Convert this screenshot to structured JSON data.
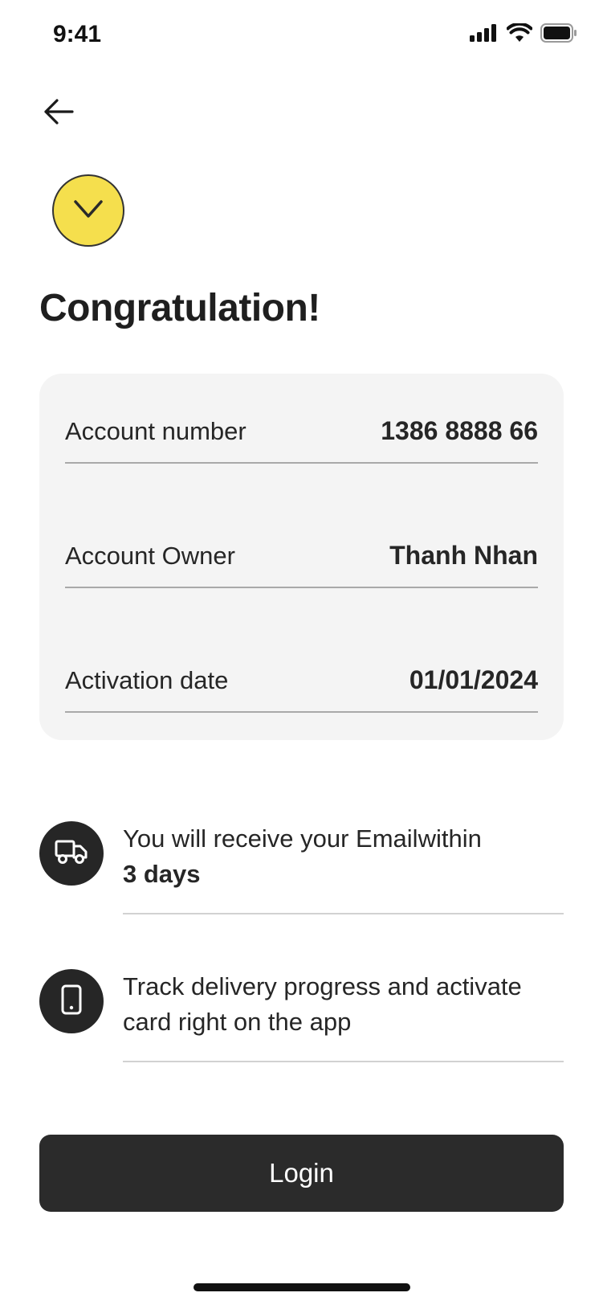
{
  "status_bar": {
    "time": "9:41",
    "icons": [
      "cellular-signal-icon",
      "wifi-icon",
      "battery-icon"
    ]
  },
  "header": {
    "back_icon": "arrow-left-icon"
  },
  "success_icon": "check-icon",
  "title": "Congratulation!",
  "details": [
    {
      "label": "Account number",
      "value": "1386 8888 66"
    },
    {
      "label": "Account Owner",
      "value": "Thanh Nhan"
    },
    {
      "label": "Activation date",
      "value": "01/01/2024"
    }
  ],
  "features": [
    {
      "icon": "truck-icon",
      "text": "You will receive your Emailwithin",
      "bold": "3 days"
    },
    {
      "icon": "smartphone-icon",
      "text": "Track delivery progress and activate card right on the app"
    }
  ],
  "login_button": {
    "label": "Login"
  },
  "colors": {
    "accent_yellow": "#F5DF4D",
    "dark": "#2B2B2B",
    "card_bg": "#F4F4F4"
  }
}
